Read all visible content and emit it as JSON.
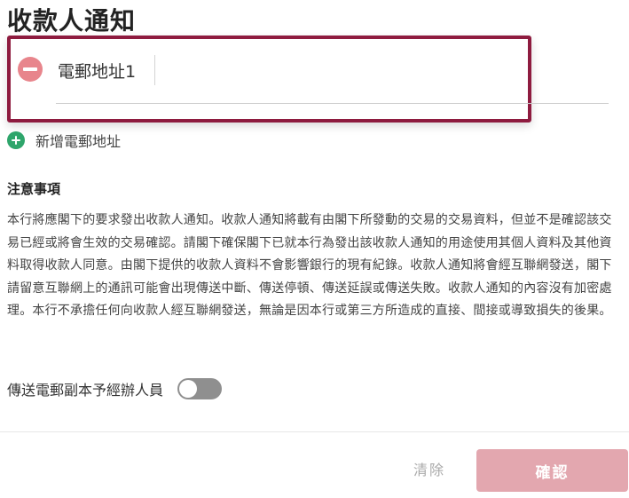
{
  "page_title": "收款人通知",
  "email_entry": {
    "label": "電郵地址1",
    "value": ""
  },
  "add_email_label": "新增電郵地址",
  "notes": {
    "heading": "注意事項",
    "body": "本行將應閣下的要求發出收款人通知。收款人通知將載有由閣下所發動的交易的交易資料，但並不是確認該交易已經或將會生效的交易確認。請閣下確保閣下已就本行為發出該收款人通知的用途使用其個人資料及其他資料取得收款人同意。由閣下提供的收款人資料不會影響銀行的現有紀錄。收款人通知將會經互聯網發送，閣下請留意互聯網上的通訊可能會出現傳送中斷、傳送停頓、傳送延誤或傳送失敗。收款人通知的內容沒有加密處理。本行不承擔任何向收款人經互聯網發送，無論是因本行或第三方所造成的直接、間接或導致損失的後果。"
  },
  "copy_toggle": {
    "label": "傳送電郵副本予經辦人員",
    "state": "off"
  },
  "footer": {
    "clear_label": "清除",
    "confirm_label": "確認"
  },
  "colors": {
    "card_border": "#8e1b3f",
    "remove_icon": "#e8858c",
    "add_icon": "#2ea56b",
    "confirm_button": "#e3a7af",
    "toggle_off": "#8f8f8f"
  }
}
